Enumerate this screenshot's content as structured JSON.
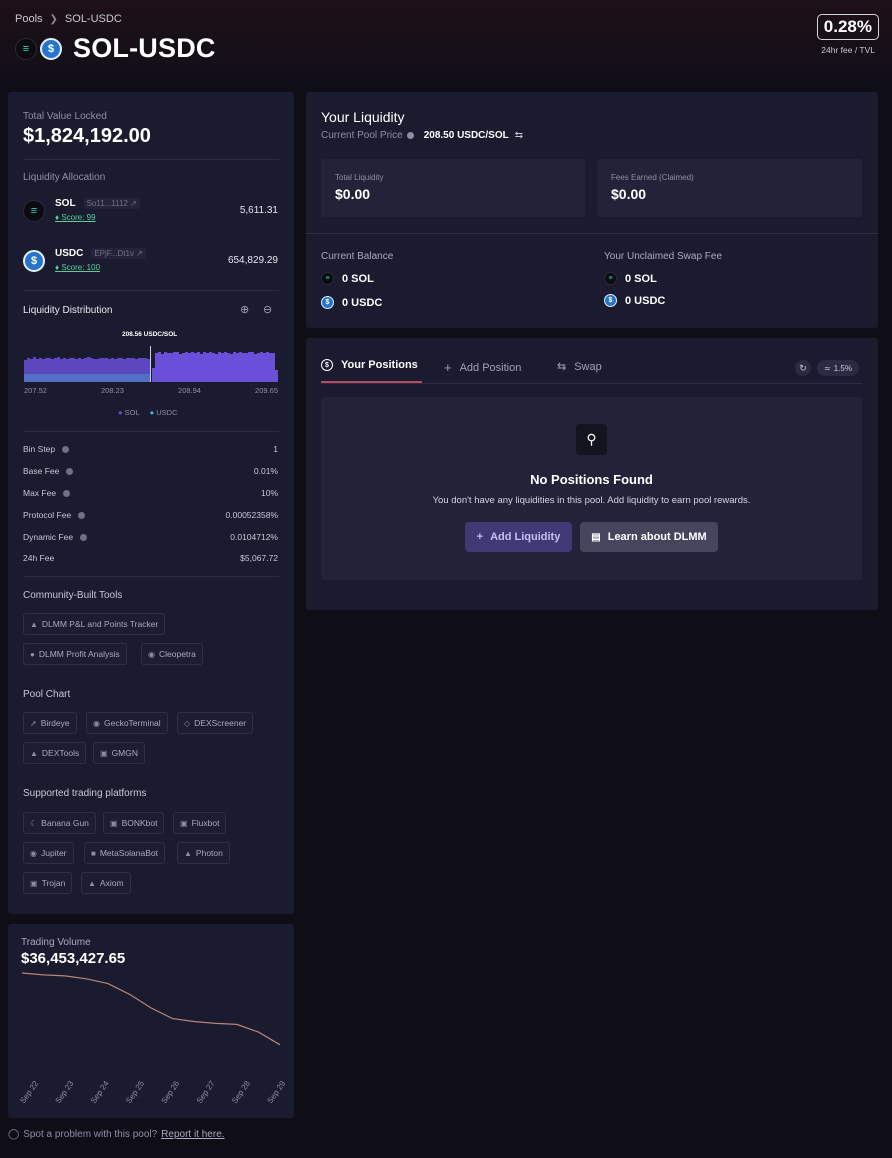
{
  "breadcrumb": {
    "root": "Pools",
    "current": "SOL-USDC"
  },
  "header": {
    "title": "SOL-USDC",
    "fee_pct": "0.28%",
    "fee_label": "24hr fee / TVL"
  },
  "tvl": {
    "label": "Total Value Locked",
    "value": "$1,824,192.00"
  },
  "allocation": {
    "label": "Liquidity Allocation",
    "tokens": [
      {
        "symbol": "SOL",
        "address": "So11...1112",
        "score": "Score: 99",
        "amount": "5,611.31"
      },
      {
        "symbol": "USDC",
        "address": "EPjF...Dt1v",
        "score": "Score: 100",
        "amount": "654,829.29"
      }
    ]
  },
  "distribution": {
    "label": "Liquidity Distribution",
    "price_tag": "208.56 USDC/SOL",
    "ticks": [
      "207.52",
      "208.23",
      "208.94",
      "209.65"
    ],
    "legend": [
      "SOL",
      "USDC"
    ],
    "colors": {
      "sol": "#6a4fd8",
      "usdc": "#3fb7d6"
    },
    "sol_bars": [
      0.55,
      0.6,
      0.58,
      0.62,
      0.57,
      0.6,
      0.58,
      0.61,
      0.59,
      0.57,
      0.6,
      0.62,
      0.58,
      0.6,
      0.57,
      0.59,
      0.61,
      0.58,
      0.6,
      0.57,
      0.59,
      0.62,
      0.6,
      0.58,
      0.57,
      0.6,
      0.59,
      0.61,
      0.58,
      0.6,
      0.57,
      0.59,
      0.6,
      0.58,
      0.6,
      0.59,
      0.61,
      0.58,
      0.6,
      0.59,
      0.6,
      0.58
    ],
    "usdc_bars": [
      0.35,
      0.72,
      0.74,
      0.7,
      0.75,
      0.73,
      0.72,
      0.76,
      0.74,
      0.71,
      0.73,
      0.75,
      0.72,
      0.74,
      0.73,
      0.76,
      0.71,
      0.74,
      0.72,
      0.75,
      0.73,
      0.7,
      0.74,
      0.72,
      0.76,
      0.73,
      0.71,
      0.74,
      0.72,
      0.75,
      0.73,
      0.72,
      0.74,
      0.76,
      0.71,
      0.73,
      0.75,
      0.72,
      0.74,
      0.73,
      0.72,
      0.3
    ]
  },
  "fees": [
    {
      "label": "Bin Step",
      "value": "1",
      "info": true
    },
    {
      "label": "Base Fee",
      "value": "0.01%",
      "info": true
    },
    {
      "label": "Max Fee",
      "value": "10%",
      "info": true
    },
    {
      "label": "Protocol Fee",
      "value": "0.00052358%",
      "info": true
    },
    {
      "label": "Dynamic Fee",
      "value": "0.0104712%",
      "info": true
    },
    {
      "label": "24h Fee",
      "value": "$5,067.72",
      "info": false
    }
  ],
  "community": {
    "label": "Community-Built Tools",
    "tools": [
      "DLMM P&L and Points Tracker",
      "DLMM Profit Analysis",
      "Cleopetra"
    ]
  },
  "pool_chart": {
    "label": "Pool Chart",
    "links": [
      "Birdeye",
      "GeckoTerminal",
      "DEXScreener",
      "DEXTools",
      "GMGN"
    ]
  },
  "platforms": {
    "label": "Supported trading platforms",
    "items": [
      "Banana Gun",
      "BONKbot",
      "Fluxbot",
      "Jupiter",
      "MetaSolanaBot",
      "Photon",
      "Trojan",
      "Axiom"
    ]
  },
  "your_liquidity": {
    "title": "Your Liquidity",
    "price_label": "Current Pool Price",
    "price": "208.50 USDC/SOL",
    "total_label": "Total Liquidity",
    "total": "$0.00",
    "fees_label": "Fees Earned (Claimed)",
    "fees": "$0.00",
    "balance_label": "Current Balance",
    "balance_sol": "0 SOL",
    "balance_usdc": "0 USDC",
    "unclaimed_label": "Your Unclaimed Swap Fee",
    "unclaimed_sol": "0 SOL",
    "unclaimed_usdc": "0 USDC"
  },
  "positions": {
    "tabs": [
      "Your Positions",
      "Add Position",
      "Swap"
    ],
    "slippage": "1.5%",
    "empty_title": "No Positions Found",
    "empty_text": "You don't have any liquidities in this pool. Add liquidity to earn pool rewards.",
    "add_btn": "Add Liquidity",
    "learn_btn": "Learn about DLMM"
  },
  "volume": {
    "label": "Trading Volume",
    "value": "$36,453,427.65",
    "dates": [
      "Sep 22",
      "Sep 23",
      "Sep 24",
      "Sep 25",
      "Sep 26",
      "Sep 27",
      "Sep 28",
      "Sep 29"
    ],
    "line_color": "#b9867a",
    "series": [
      0.99,
      0.97,
      0.96,
      0.93,
      0.88,
      0.77,
      0.63,
      0.52,
      0.49,
      0.47,
      0.46,
      0.38,
      0.25
    ]
  },
  "footer": {
    "text": "Spot a problem with this pool?",
    "link": "Report it here."
  }
}
